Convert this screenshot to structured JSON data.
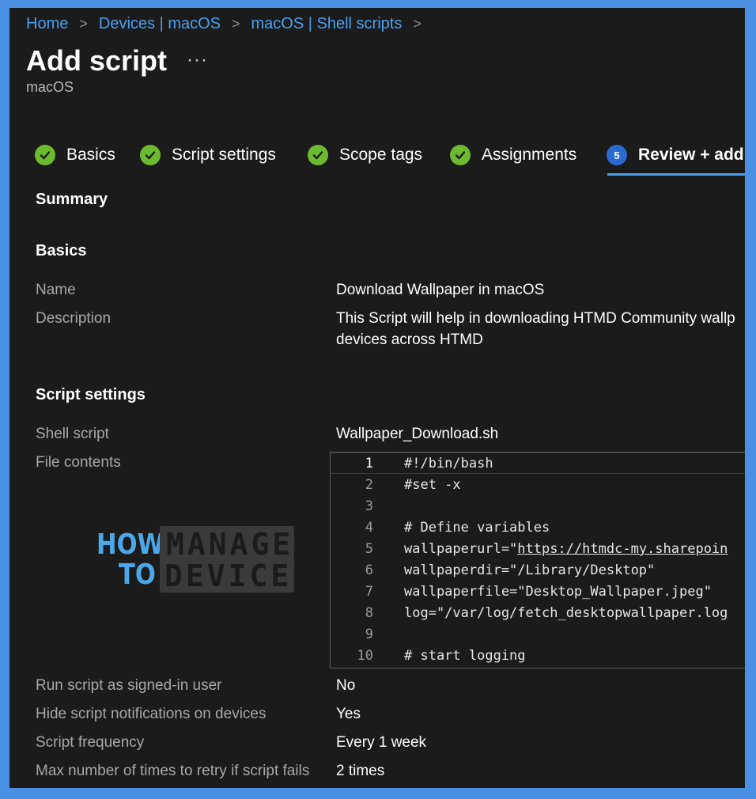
{
  "breadcrumb": {
    "items": [
      "Home",
      "Devices | macOS",
      "macOS | Shell scripts"
    ]
  },
  "page": {
    "title": "Add script",
    "more_label": "···",
    "subtitle": "macOS"
  },
  "tabs": [
    {
      "label": "Basics",
      "status": "done"
    },
    {
      "label": "Script settings",
      "status": "done"
    },
    {
      "label": "Scope tags",
      "status": "done"
    },
    {
      "label": "Assignments",
      "status": "done"
    },
    {
      "label": "Review + add",
      "status": "active",
      "step": "5"
    }
  ],
  "summary": {
    "heading": "Summary",
    "basics": {
      "heading": "Basics",
      "name_label": "Name",
      "name_value": "Download Wallpaper in macOS",
      "description_label": "Description",
      "description_line1": "This Script will help in downloading HTMD Community wallp",
      "description_line2": "devices across HTMD"
    },
    "script_settings": {
      "heading": "Script settings",
      "shell_label": "Shell script",
      "shell_value": "Wallpaper_Download.sh",
      "file_label": "File contents",
      "run_label": "Run script as signed-in user",
      "run_value": "No",
      "hide_label": "Hide script notifications on devices",
      "hide_value": "Yes",
      "freq_label": "Script frequency",
      "freq_value": "Every 1 week",
      "retry_label": "Max number of times to retry if script fails",
      "retry_value": "2 times"
    }
  },
  "code": {
    "lines": [
      {
        "n": "1",
        "text": "#!/bin/bash"
      },
      {
        "n": "2",
        "text": "#set -x"
      },
      {
        "n": "3",
        "text": ""
      },
      {
        "n": "4",
        "text": "# Define variables"
      },
      {
        "n": "5",
        "pre": "wallpaperurl=\"",
        "link": "https://htmdc-my.sharepoin"
      },
      {
        "n": "6",
        "text": "wallpaperdir=\"/Library/Desktop\""
      },
      {
        "n": "7",
        "text": "wallpaperfile=\"Desktop_Wallpaper.jpeg\""
      },
      {
        "n": "8",
        "text": "log=\"/var/log/fetch_desktopwallpaper.log"
      },
      {
        "n": "9",
        "text": ""
      },
      {
        "n": "10",
        "text": "# start logging"
      }
    ]
  },
  "watermark": {
    "how": "HOW",
    "to": "TO",
    "manage": "MANAGE",
    "devices": "DEVICES"
  },
  "colors": {
    "accent": "#4ba0f0",
    "check": "#6cba2f",
    "step": "#2b6bd1",
    "background": "#1b1b1b",
    "border": "#4a90e2"
  },
  "icons": {
    "tab_done": "check-circle-icon",
    "breadcrumb_separator": "chevron-right-icon"
  }
}
